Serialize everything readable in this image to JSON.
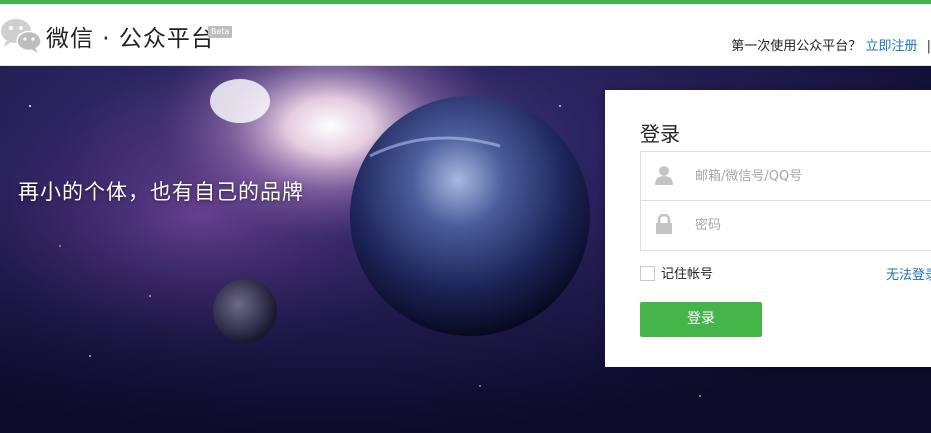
{
  "header": {
    "brand_name": "微信 · 公众平台",
    "beta_badge": "Beta",
    "first_time_text": "第一次使用公众平台？",
    "register_link": "立即注册",
    "separator": "|"
  },
  "banner": {
    "slogan": "再小的个体，也有自己的品牌"
  },
  "login": {
    "title": "登录",
    "account_placeholder": "邮箱/微信号/QQ号",
    "password_placeholder": "密码",
    "remember_label": "记住帐号",
    "forgot_link": "无法登录",
    "submit_label": "登录"
  },
  "colors": {
    "accent_green": "#44b549",
    "link_blue": "#1e73be",
    "top_strip": "#3fb34f"
  }
}
